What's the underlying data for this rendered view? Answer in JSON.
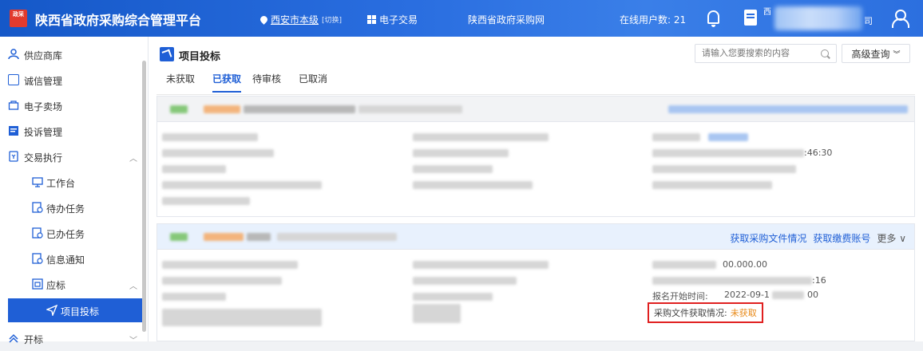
{
  "header": {
    "logo_text": "政采",
    "app_title": "陕西省政府采购综合管理平台",
    "region": "西安市本级",
    "region_switch": "[切换]",
    "trade_label": "电子交易",
    "site_link": "陕西省政府采购网",
    "online_users": "在线用户数: 21",
    "org_prefix": "西",
    "org_suffix": "司",
    "brand_color": "#2a6ee0"
  },
  "sidebar": {
    "items": [
      {
        "label": "供应商库",
        "icon": "user-icon"
      },
      {
        "label": "诚信管理",
        "icon": "card-icon"
      },
      {
        "label": "电子卖场",
        "icon": "store-icon"
      },
      {
        "label": "投诉管理",
        "icon": "complaint-icon"
      },
      {
        "label": "交易执行",
        "icon": "transaction-icon"
      },
      {
        "label": "工作台",
        "icon": "workbench-icon"
      },
      {
        "label": "待办任务",
        "icon": "task-icon"
      },
      {
        "label": "已办任务",
        "icon": "task-icon"
      },
      {
        "label": "信息通知",
        "icon": "task-icon"
      },
      {
        "label": "应标",
        "icon": "bid-icon"
      },
      {
        "label": "项目投标",
        "icon": "send-icon"
      },
      {
        "label": "开标",
        "icon": "open-icon"
      }
    ]
  },
  "main": {
    "title": "项目投标",
    "search_placeholder": "请输入您要搜索的内容",
    "advanced_label": "高级查询",
    "tabs": [
      "未获取",
      "已获取",
      "待审核",
      "已取消"
    ],
    "active_tab": "已获取",
    "card1": {
      "time_fragment": ":46:30"
    },
    "card2": {
      "actions": [
        "获取采购文件情况",
        "获取缴费账号",
        "更多"
      ],
      "amount_fragment": "00.000.00",
      "time_fragment1": ":16",
      "reg_start_label": "报名开始时间:",
      "reg_start_value": "2022-09-1",
      "time_fragment2": "00",
      "status_label": "采购文件获取情况:",
      "status_value": "未获取",
      "status_color": "#e88a1a"
    }
  }
}
